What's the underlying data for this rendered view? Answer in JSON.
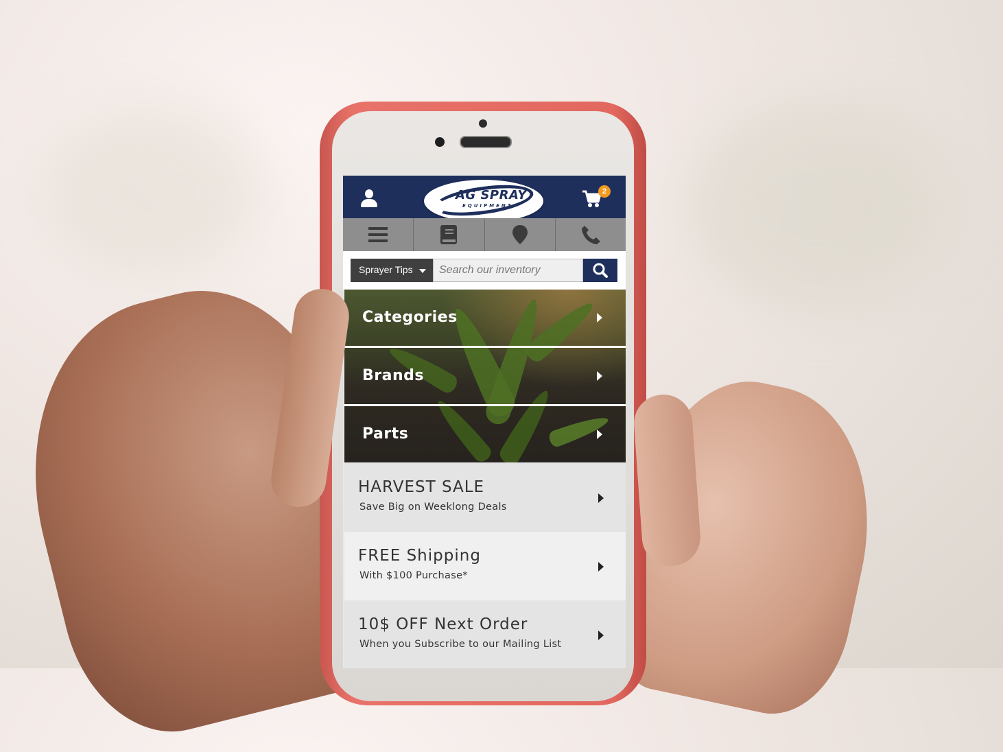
{
  "header": {
    "logo_line1": "AG SPRAY",
    "logo_line2": "EQUIPMENT",
    "cart_count": "2"
  },
  "icon_bar": [
    "menu-icon",
    "book-icon",
    "map-pin-icon",
    "phone-icon"
  ],
  "search": {
    "dropdown_label": "Sprayer Tips",
    "placeholder": "Search our inventory"
  },
  "nav": [
    {
      "label": "Categories"
    },
    {
      "label": "Brands"
    },
    {
      "label": "Parts"
    }
  ],
  "promos": [
    {
      "title": "HARVEST SALE",
      "subtitle": "Save Big on Weeklong Deals"
    },
    {
      "title": "FREE Shipping",
      "subtitle": "With $100 Purchase*"
    },
    {
      "title": "10$ OFF Next Order",
      "subtitle": "When you Subscribe to our Mailing List"
    }
  ],
  "colors": {
    "brand_navy": "#1e2f5c",
    "badge_orange": "#f39a1e",
    "icon_bar_gray": "#8c8c8c"
  }
}
